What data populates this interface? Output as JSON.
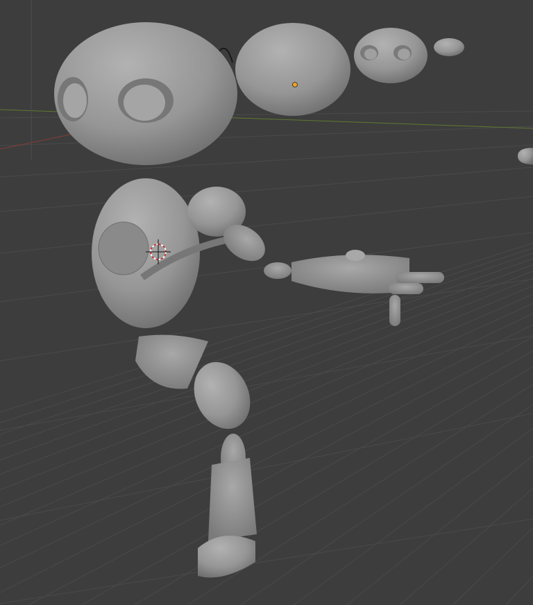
{
  "viewport": {
    "background": "#3d3d3d",
    "grid_color": "#4a4a4a",
    "x_axis_color": "#8a3b3b",
    "y_axis_color": "#5f7a30",
    "model_color": "#9b9b9b",
    "model_shadow": "#6a6a6a",
    "origin_color": "#f0a020"
  },
  "icons": {
    "cursor": "3d-cursor-icon",
    "origin": "object-origin-icon"
  }
}
